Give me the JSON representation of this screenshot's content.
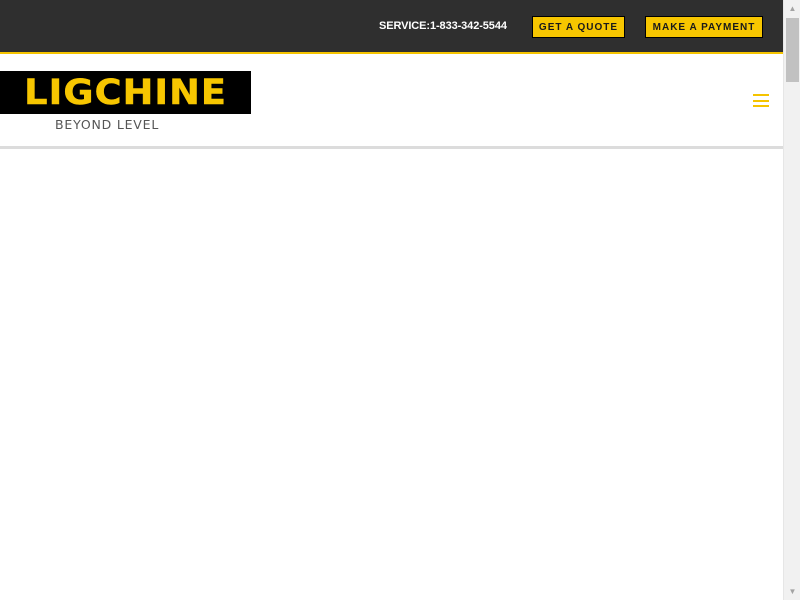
{
  "topbar": {
    "service_label": "SERVICE:",
    "service_phone": "1-833-342-5544",
    "quote_button": "GET A QUOTE",
    "payment_button": "MAKE A PAYMENT"
  },
  "header": {
    "logo_text": "LIGCHINE",
    "logo_tagline": "BEYOND LEVEL",
    "menu_icon": "hamburger-menu-icon"
  },
  "scrollbar": {
    "up_icon": "▲",
    "down_icon": "▼"
  },
  "colors": {
    "accent": "#f7c600",
    "topbar_bg": "#2f2f2f",
    "logo_bg": "#000000"
  }
}
